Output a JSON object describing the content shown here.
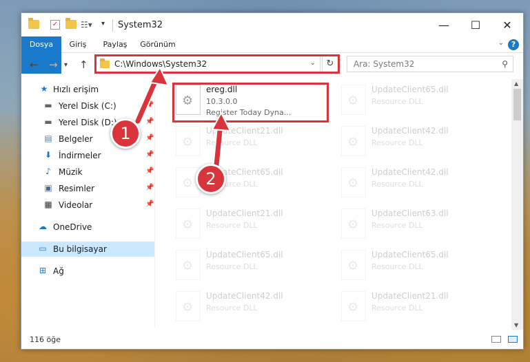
{
  "window": {
    "title": "System32"
  },
  "window_controls": {
    "minimize": "—",
    "maximize": "☐",
    "close": "✕"
  },
  "ribbon": {
    "tabs": [
      "Dosya",
      "Giriş",
      "Paylaş",
      "Görünüm"
    ],
    "help": "?"
  },
  "address": {
    "path": "C:\\Windows\\System32",
    "search_placeholder": "Ara: System32"
  },
  "sidebar": {
    "items": [
      {
        "label": "Hızlı erişim",
        "icon": "star-icon",
        "glyph": "★"
      },
      {
        "label": "Yerel Disk (C:)",
        "icon": "drive-icon",
        "glyph": "▬"
      },
      {
        "label": "Yerel Disk (D:)",
        "icon": "drive-icon",
        "glyph": "▬"
      },
      {
        "label": "Belgeler",
        "icon": "document-icon",
        "glyph": "▤"
      },
      {
        "label": "İndirmeler",
        "icon": "download-icon",
        "glyph": "⬇"
      },
      {
        "label": "Müzik",
        "icon": "music-icon",
        "glyph": "♪"
      },
      {
        "label": "Resimler",
        "icon": "picture-icon",
        "glyph": "▣"
      },
      {
        "label": "Videolar",
        "icon": "video-icon",
        "glyph": "▦"
      },
      {
        "label": "OneDrive",
        "icon": "cloud-icon",
        "glyph": "☁"
      },
      {
        "label": "Bu bilgisayar",
        "icon": "computer-icon",
        "glyph": "▭"
      },
      {
        "label": "Ağ",
        "icon": "network-icon",
        "glyph": "⊞"
      }
    ]
  },
  "files": [
    {
      "name": "ereg.dll",
      "version": "10.3.0.0",
      "desc": "Register Today Dyna...",
      "faded": false
    },
    {
      "name": "UpdateClient65.dll",
      "version": "Resource DLL",
      "desc": "",
      "faded": true
    },
    {
      "name": "UpdateClient21.dll",
      "version": "Resource DLL",
      "desc": "",
      "faded": true
    },
    {
      "name": "UpdateClient42.dll",
      "version": "Resource DLL",
      "desc": "",
      "faded": true
    },
    {
      "name": "UpdateClient65.dll",
      "version": "Resource DLL",
      "desc": "",
      "faded": true
    },
    {
      "name": "UpdateClient42.dll",
      "version": "Resource DLL",
      "desc": "",
      "faded": true
    },
    {
      "name": "UpdateClient21.dll",
      "version": "Resource DLL",
      "desc": "",
      "faded": true
    },
    {
      "name": "UpdateClient63.dll",
      "version": "Resource DLL",
      "desc": "",
      "faded": true
    },
    {
      "name": "UpdateClient65.dll",
      "version": "Resource DLL",
      "desc": "",
      "faded": true
    },
    {
      "name": "UpdateClient65.dll",
      "version": "Resource DLL",
      "desc": "",
      "faded": true
    },
    {
      "name": "UpdateClient42.dll",
      "version": "Resource DLL",
      "desc": "",
      "faded": true
    },
    {
      "name": "UpdateClient21.dll",
      "version": "Resource DLL",
      "desc": "",
      "faded": true
    }
  ],
  "status": {
    "count": "116 öğe"
  },
  "callouts": [
    "1",
    "2"
  ],
  "colors": {
    "accent": "#1979ca",
    "highlight": "#d7343b",
    "selected": "#cce8ff"
  }
}
